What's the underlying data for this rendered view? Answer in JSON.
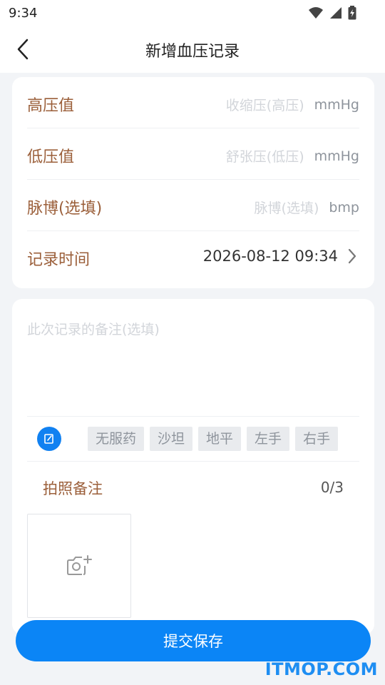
{
  "status": {
    "time": "9:34"
  },
  "header": {
    "title": "新增血压记录"
  },
  "form": {
    "systolic": {
      "label": "高压值",
      "placeholder": "收缩压(高压)",
      "unit": "mmHg"
    },
    "diastolic": {
      "label": "低压值",
      "placeholder": "舒张压(低压)",
      "unit": "mmHg"
    },
    "pulse": {
      "label": "脉博(选填)",
      "placeholder": "脉博(选填)",
      "unit": "bmp"
    },
    "record_time": {
      "label": "记录时间",
      "value": "2026-08-12 09:34"
    }
  },
  "notes": {
    "placeholder": "此次记录的备注(选填)",
    "tags": [
      "无服药",
      "沙坦",
      "地平",
      "左手",
      "右手"
    ],
    "photo_label": "拍照备注",
    "photo_count": "0/3"
  },
  "actions": {
    "submit_label": "提交保存"
  },
  "watermark": "ITMOP.COM",
  "colors": {
    "primary": "#0b85f6",
    "label": "#9b5f3a",
    "placeholder": "#d2d5da"
  }
}
